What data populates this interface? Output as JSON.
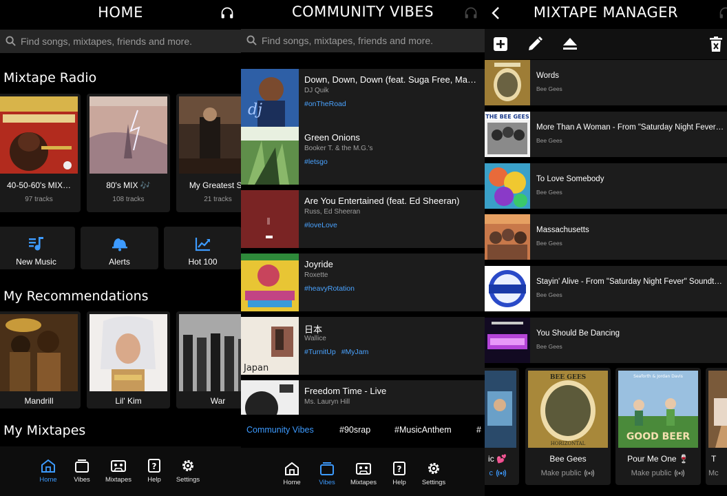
{
  "colors": {
    "accent": "#3d9bff",
    "tag": "#4aa3ff",
    "card": "#1a1a1a",
    "row": "#1c1c1c",
    "background": "#000000"
  },
  "home": {
    "title": "HOME",
    "headphones_icon": "headphones-icon",
    "search_placeholder": "Find songs, mixtapes, friends and more.",
    "mixtape_radio": {
      "heading": "Mixtape Radio",
      "cards": [
        {
          "name": "40-50-60's MIX…",
          "tracks": "97 tracks"
        },
        {
          "name": "80's MIX 🎶",
          "tracks": "108 tracks"
        },
        {
          "name": "My Greatest So",
          "tracks": "21 tracks"
        }
      ]
    },
    "quick": [
      {
        "label": "New Music",
        "icon": "music-note-list-icon"
      },
      {
        "label": "Alerts",
        "icon": "bells-icon"
      },
      {
        "label": "Hot 100",
        "icon": "trending-chart-icon"
      }
    ],
    "recommendations": {
      "heading": "My Recommendations",
      "items": [
        {
          "name": "Mandrill"
        },
        {
          "name": "Lil' Kim"
        },
        {
          "name": "War"
        }
      ]
    },
    "mixtapes_heading": "My Mixtapes"
  },
  "vibes": {
    "title": "COMMUNITY VIBES",
    "search_placeholder": "Find songs, mixtapes, friends and more.",
    "posts": [
      {
        "title": "Down, Down, Down (feat. Suga Free, Ma…",
        "artist": "DJ Quik",
        "tags": [
          "#onTheRoad"
        ]
      },
      {
        "title": "Green Onions",
        "artist": "Booker T. & the M.G.'s",
        "tags": [
          "#letsgo"
        ]
      },
      {
        "title": "Are You Entertained (feat. Ed Sheeran)",
        "artist": "Russ, Ed Sheeran",
        "tags": [
          "#loveLove"
        ]
      },
      {
        "title": "Joyride",
        "artist": "Roxette",
        "tags": [
          "#heavyRotation"
        ]
      },
      {
        "title": "日本",
        "artist": "Wallice",
        "tags": [
          "#TurnitUp",
          "#MyJam"
        ]
      },
      {
        "title": "Freedom Time - Live",
        "artist": "Ms. Lauryn Hill",
        "tags": []
      }
    ],
    "hashtag_bar": [
      "Community Vibes",
      "#90srap",
      "#MusicAnthem",
      "#"
    ]
  },
  "manager": {
    "title": "MIXTAPE MANAGER",
    "tools": [
      "add-icon",
      "pencil-icon",
      "eject-icon",
      "trash-icon"
    ],
    "songs": [
      {
        "title": "Words",
        "artist": "Bee Gees"
      },
      {
        "title": "More Than A Woman - From \"Saturday Night Fever…",
        "artist": "Bee Gees"
      },
      {
        "title": "To Love Somebody",
        "artist": "Bee Gees"
      },
      {
        "title": "Massachusetts",
        "artist": "Bee Gees"
      },
      {
        "title": "Stayin' Alive - From \"Saturday Night Fever\" Soundtr…",
        "artist": "Bee Gees"
      },
      {
        "title": "You Should Be Dancing",
        "artist": "Bee Gees"
      }
    ],
    "mixtapes": [
      {
        "name": "ic 💕",
        "status": "c"
      },
      {
        "name": "Bee Gees",
        "status": "Make public"
      },
      {
        "name": "Pour Me One 🍷",
        "status": "Make public"
      },
      {
        "name": "T",
        "status": "Mc"
      }
    ],
    "art_text": {
      "bee_gees": "BEE GEES",
      "horizontal": "HORIZONTAL",
      "good_beer": "GOOD BEER",
      "good_beer_top": "Seaforth & Jordan Davis"
    }
  },
  "tabs": [
    {
      "label": "Home",
      "icon": "home-icon"
    },
    {
      "label": "Vibes",
      "icon": "vibes-icon"
    },
    {
      "label": "Mixtapes",
      "icon": "cassette-icon"
    },
    {
      "label": "Help",
      "icon": "help-icon"
    },
    {
      "label": "Settings",
      "icon": "gear-icon"
    }
  ]
}
